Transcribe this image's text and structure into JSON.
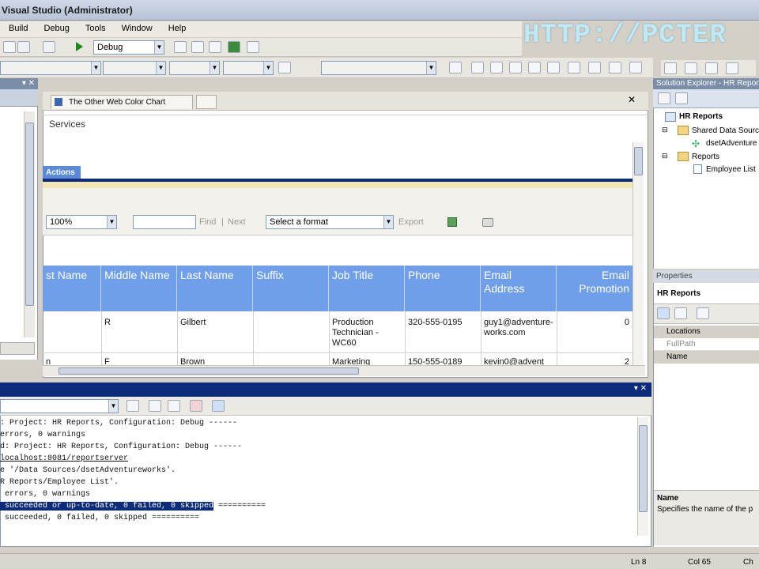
{
  "window": {
    "title": "Visual Studio (Administrator)"
  },
  "watermark": "HTTP://PCTER",
  "menu": {
    "items": [
      "Build",
      "Debug",
      "Tools",
      "Window",
      "Help"
    ]
  },
  "toolbar": {
    "config": "Debug"
  },
  "document": {
    "tab_title": "The Other Web Color Chart",
    "services_text": "Services",
    "actions_tab": "Actions",
    "zoom": "100%",
    "find": "Find",
    "separator": "|",
    "next": "Next",
    "format": "Select a format",
    "export": "Export",
    "columns": [
      "st Name",
      "Middle Name",
      "Last Name",
      "Suffix",
      "Job Title",
      "Phone",
      "Email Address",
      "Email Promotion"
    ],
    "rows": [
      [
        "",
        "R",
        "Gilbert",
        "",
        "Production Technician - WC60",
        "320-555-0195",
        "guy1@adventure-works.com",
        "0"
      ],
      [
        "n",
        "F",
        "Brown",
        "",
        "Marketing",
        "150-555-0189",
        "kevin0@advent",
        "2"
      ]
    ]
  },
  "output": {
    "lines": [
      ": Project: HR Reports, Configuration: Debug ------",
      "errors, 0 warnings",
      "d: Project: HR Reports, Configuration: Debug ------",
      "localhost:8081/reportserver",
      "e '/Data Sources/dsetAdventureworks'.",
      "R Reports/Employee List'.",
      " errors, 0 warnings",
      " succeeded or up-to-date, 0 failed, 0 skipped",
      " succeeded, 0 failed, 0 skipped =========="
    ],
    "line8_suffix": " =========="
  },
  "solution_explorer": {
    "title": "Solution Explorer - HR Reports",
    "project": "HR Reports",
    "shared": "Shared Data Sources",
    "datasource": "dsetAdventure",
    "reports": "Reports",
    "employee_list": "Employee List"
  },
  "properties": {
    "title": "Properties",
    "object": "HR Reports",
    "category": "Locations",
    "fullpath": "FullPath",
    "name_row": "Name",
    "desc_title": "Name",
    "desc_text": "Specifies the name of the p"
  },
  "status": {
    "ln": "Ln 8",
    "col": "Col 65",
    "ch": "Ch"
  }
}
